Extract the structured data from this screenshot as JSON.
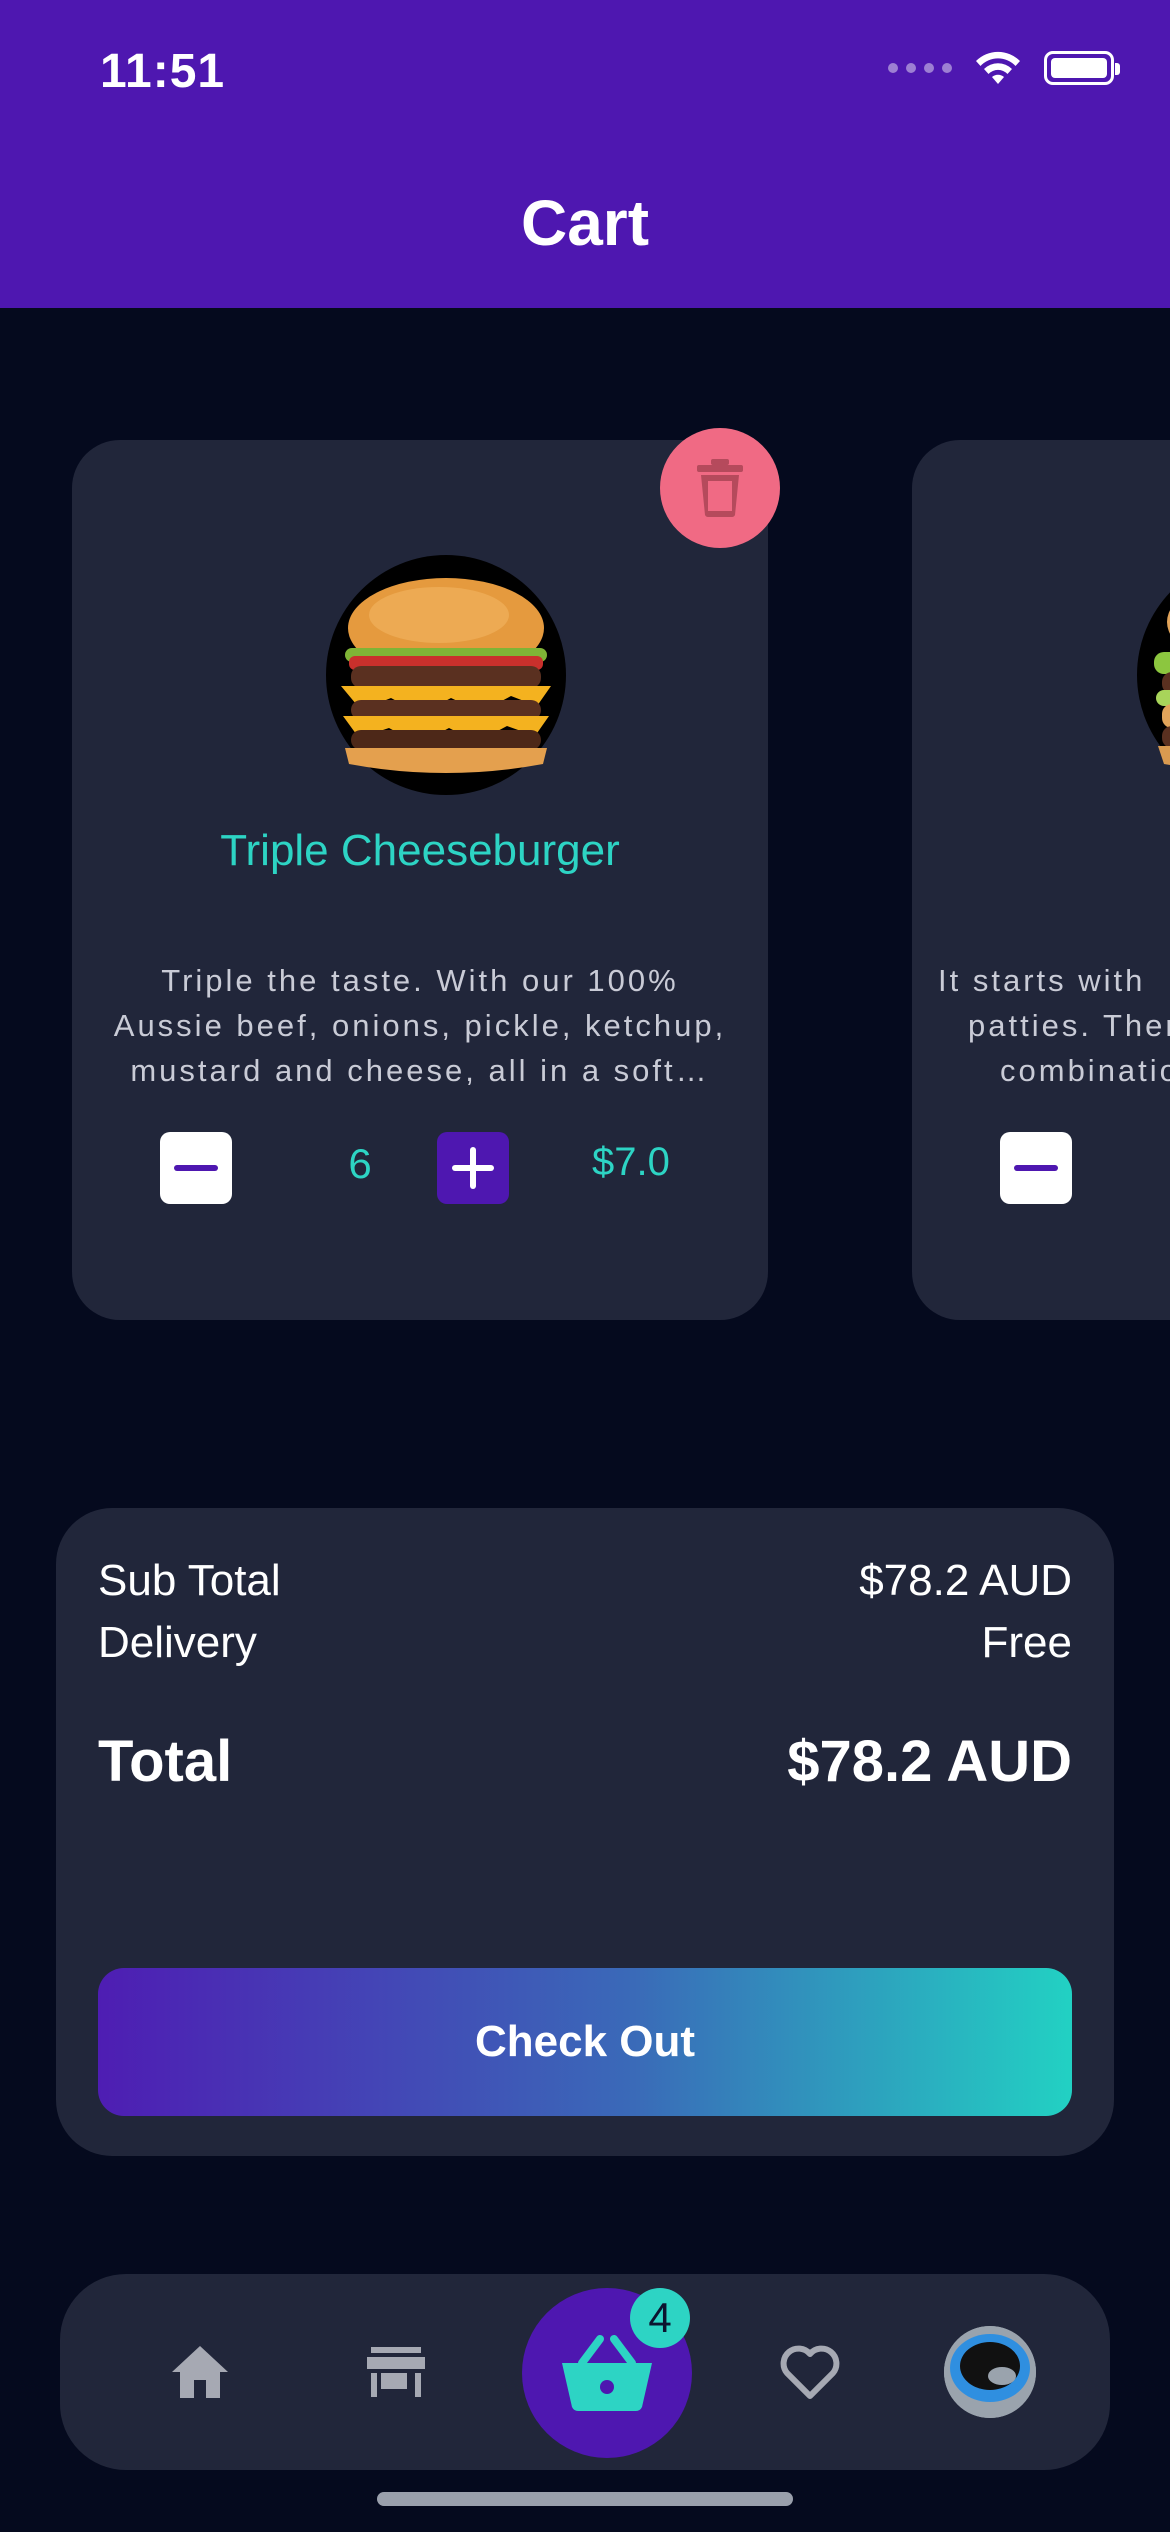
{
  "status_bar": {
    "time": "11:51"
  },
  "header": {
    "title": "Cart"
  },
  "cart_items": [
    {
      "name": "Triple Cheeseburger",
      "description_lines": [
        "Triple the taste. With our 100%",
        "Aussie beef, onions, pickle, ketchup,",
        "mustard and cheese, all in a soft…"
      ],
      "quantity": "6",
      "price": "$7.0"
    },
    {
      "name": "",
      "description_lines": [
        "It starts with",
        "patties. Ther",
        "combinatio"
      ],
      "quantity": "",
      "price": ""
    }
  ],
  "summary": {
    "subtotal_label": "Sub Total",
    "subtotal_value": "$78.2 AUD",
    "delivery_label": "Delivery",
    "delivery_value": "Free",
    "total_label": "Total",
    "total_value": "$78.2 AUD",
    "checkout_label": "Check Out"
  },
  "bottom_nav": {
    "items": [
      "home-icon",
      "store-icon",
      "basket-icon",
      "heart-icon",
      "avatar"
    ],
    "cart_badge": "4"
  },
  "colors": {
    "header": "#4e17b0",
    "background": "#050a1e",
    "card": "#21263a",
    "accent_teal": "#2dd4c4",
    "delete_pink": "#f06a84"
  }
}
